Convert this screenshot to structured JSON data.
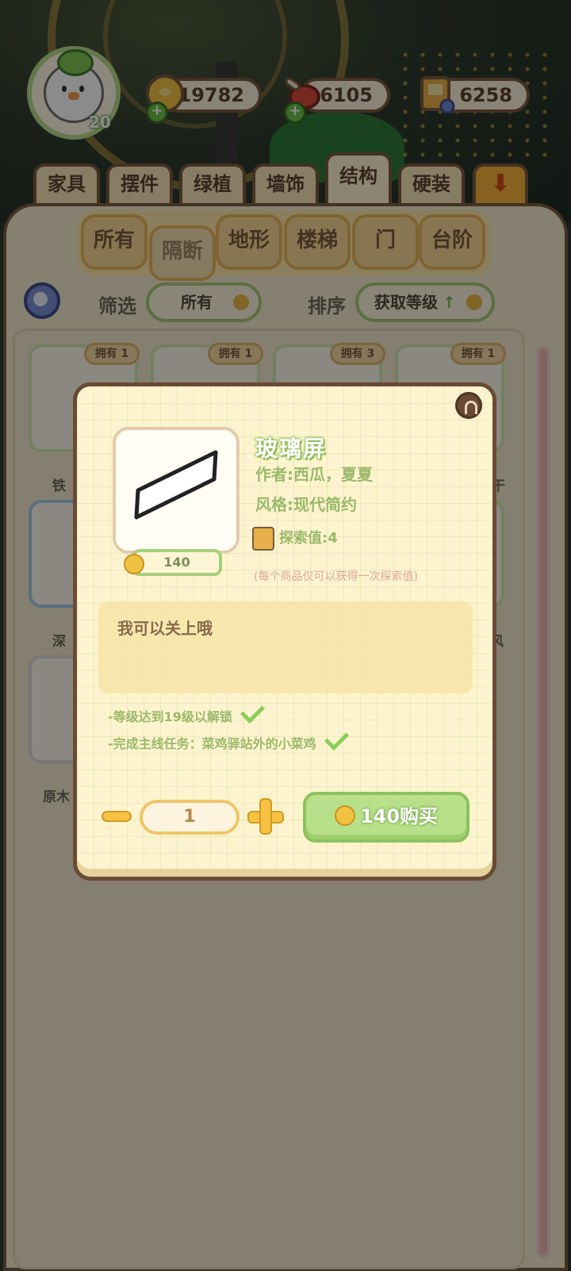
{
  "player": {
    "level": "20"
  },
  "currencies": [
    {
      "name": "coin-icon",
      "value": "19782"
    },
    {
      "name": "meat-icon",
      "value": "6105"
    },
    {
      "name": "book-icon",
      "value": "6258"
    }
  ],
  "category_tabs": [
    "家具",
    "摆件",
    "绿植",
    "墙饰",
    "结构",
    "硬装"
  ],
  "active_category": "结构",
  "sub_tabs": [
    "所有",
    "隔断",
    "地形",
    "楼梯",
    "门",
    "台阶"
  ],
  "active_sub_tab": "隔断",
  "filter": {
    "label": "筛选",
    "value": "所有"
  },
  "sort": {
    "label": "排序",
    "value": "获取等级",
    "direction": "↑"
  },
  "grid": {
    "owned_badges": [
      "拥有 1",
      "拥有 1",
      "拥有 3",
      "拥有 1"
    ],
    "partial_names": [
      "铁",
      "干",
      "深",
      "风",
      "原木"
    ]
  },
  "modal": {
    "title": "玻璃屏",
    "author": "作者:西瓜，夏夏",
    "style": "风格:现代简约",
    "explore": "探索值:4",
    "explore_note": "(每个商品仅可以获得一次探索值)",
    "price": "140",
    "description": "我可以关上哦",
    "requirements": [
      "-等级达到19级以解锁",
      "-完成主线任务：菜鸡驿站外的小菜鸡"
    ],
    "quantity": "1",
    "buy_label": "140购买"
  },
  "colors": {
    "accent_green": "#9bb96b",
    "border_brown": "#6a4a34",
    "coin_gold": "#f0c242"
  }
}
